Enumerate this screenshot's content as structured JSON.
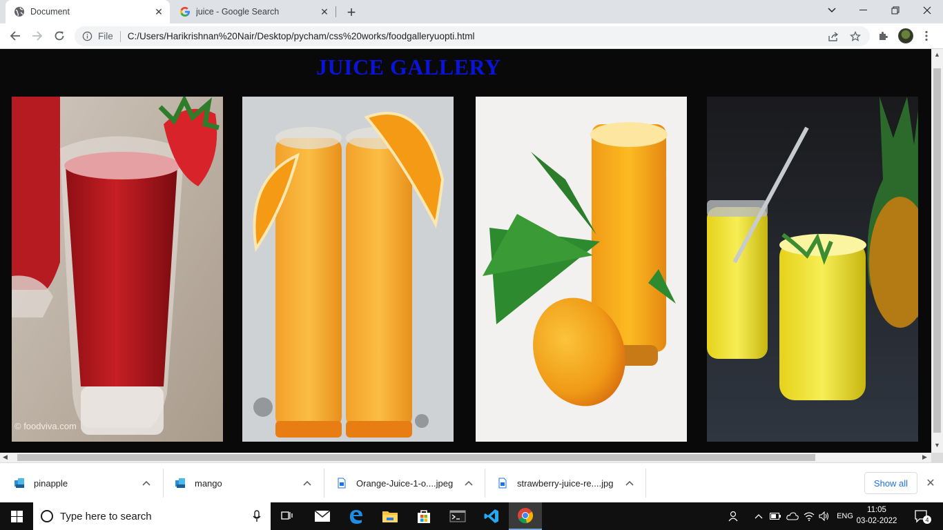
{
  "browser": {
    "tabs": [
      {
        "title": "Document",
        "favicon": "globe-icon"
      },
      {
        "title": "juice - Google Search",
        "favicon": "google-icon"
      }
    ],
    "address": {
      "scheme_label": "File",
      "url": "C:/Users/Harikrishnan%20Nair/Desktop/pycham/css%20works/foodgalleryuopti.html"
    }
  },
  "page": {
    "title": "JUICE GALLERY",
    "title_color": "#0a14d8",
    "background": "#090909",
    "images": [
      {
        "subject": "strawberry juice in tall glass",
        "watermark": "© foodviva.com"
      },
      {
        "subject": "two glasses of orange juice with orange slices"
      },
      {
        "subject": "mango juice with mango and leaves"
      },
      {
        "subject": "pineapple juice in glasses with straw"
      }
    ]
  },
  "downloads": {
    "items": [
      {
        "name": "pinapple",
        "icon": "image-file-icon"
      },
      {
        "name": "mango",
        "icon": "image-file-icon"
      },
      {
        "name": "Orange-Juice-1-o....jpeg",
        "icon": "jpeg-file-icon"
      },
      {
        "name": "strawberry-juice-re....jpg",
        "icon": "jpeg-file-icon"
      }
    ],
    "show_all_label": "Show all"
  },
  "taskbar": {
    "search_placeholder": "Type here to search",
    "language": "ENG",
    "time": "11:05",
    "date": "03-02-2022",
    "notification_count": "4"
  }
}
